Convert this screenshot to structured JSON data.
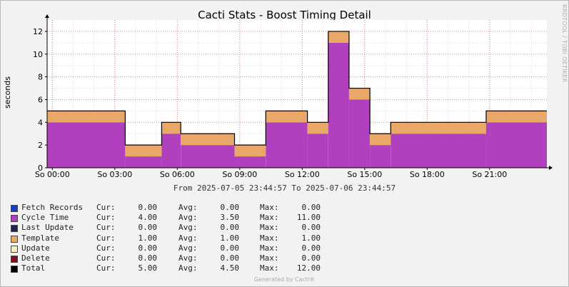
{
  "title": "Cacti Stats - Boost Timing Detail",
  "watermark": "RRDTOOL / TOBI OETIKER",
  "footer": "Generated by Cacti®",
  "chart_data": {
    "type": "area",
    "title": "Cacti Stats - Boost Timing Detail",
    "ylabel": "seconds",
    "xlabel": "",
    "date_range": "From 2025-07-05 23:44:57 To 2025-07-06 23:44:57",
    "ylim": [
      0,
      13
    ],
    "yticks": [
      0,
      2,
      4,
      6,
      8,
      10,
      12
    ],
    "xlim": [
      "2025-07-05 23:44:57",
      "2025-07-06 23:44:57"
    ],
    "xticks": [
      {
        "t": "2025-07-06 00:00",
        "label": "So 00:00"
      },
      {
        "t": "2025-07-06 03:00",
        "label": "So 03:00"
      },
      {
        "t": "2025-07-06 06:00",
        "label": "So 06:00"
      },
      {
        "t": "2025-07-06 09:00",
        "label": "So 09:00"
      },
      {
        "t": "2025-07-06 12:00",
        "label": "So 12:00"
      },
      {
        "t": "2025-07-06 15:00",
        "label": "So 15:00"
      },
      {
        "t": "2025-07-06 18:00",
        "label": "So 18:00"
      },
      {
        "t": "2025-07-06 21:00",
        "label": "So 21:00"
      }
    ],
    "grid": true,
    "stacked": true,
    "series_colors": {
      "Cycle Time": "#b140be",
      "Template": "#e8a868",
      "Total": "#000000"
    },
    "segments": [
      {
        "start": "2025-07-05 23:44:57",
        "end": "2025-07-06 03:30",
        "cycle": 4,
        "template": 1
      },
      {
        "start": "2025-07-06 03:30",
        "end": "2025-07-06 05:15",
        "cycle": 1,
        "template": 1
      },
      {
        "start": "2025-07-06 05:15",
        "end": "2025-07-06 06:10",
        "cycle": 3,
        "template": 1
      },
      {
        "start": "2025-07-06 06:10",
        "end": "2025-07-06 08:45",
        "cycle": 2,
        "template": 1
      },
      {
        "start": "2025-07-06 08:45",
        "end": "2025-07-06 10:15",
        "cycle": 1,
        "template": 1
      },
      {
        "start": "2025-07-06 10:15",
        "end": "2025-07-06 12:15",
        "cycle": 4,
        "template": 1
      },
      {
        "start": "2025-07-06 12:15",
        "end": "2025-07-06 13:15",
        "cycle": 3,
        "template": 1
      },
      {
        "start": "2025-07-06 13:15",
        "end": "2025-07-06 14:15",
        "cycle": 11,
        "template": 1
      },
      {
        "start": "2025-07-06 14:15",
        "end": "2025-07-06 15:15",
        "cycle": 6,
        "template": 1
      },
      {
        "start": "2025-07-06 15:15",
        "end": "2025-07-06 16:15",
        "cycle": 2,
        "template": 1
      },
      {
        "start": "2025-07-06 16:15",
        "end": "2025-07-06 20:50",
        "cycle": 3,
        "template": 1
      },
      {
        "start": "2025-07-06 20:50",
        "end": "2025-07-06 23:44:57",
        "cycle": 4,
        "template": 1
      }
    ]
  },
  "legend": [
    {
      "name": "Fetch Records",
      "color": "#1a3fbf",
      "cur_label": "Cur:",
      "cur": "0.00",
      "avg_label": "Avg:",
      "avg": "0.00",
      "max_label": "Max:",
      "max": "0.00"
    },
    {
      "name": "Cycle Time",
      "color": "#b140be",
      "cur_label": "Cur:",
      "cur": "4.00",
      "avg_label": "Avg:",
      "avg": "3.50",
      "max_label": "Max:",
      "max": "11.00"
    },
    {
      "name": "Last Update",
      "color": "#24244a",
      "cur_label": "Cur:",
      "cur": "0.00",
      "avg_label": "Avg:",
      "avg": "0.00",
      "max_label": "Max:",
      "max": "0.00"
    },
    {
      "name": "Template",
      "color": "#e8a868",
      "cur_label": "Cur:",
      "cur": "1.00",
      "avg_label": "Avg:",
      "avg": "1.00",
      "max_label": "Max:",
      "max": "1.00"
    },
    {
      "name": "Update",
      "color": "#f4f0c0",
      "cur_label": "Cur:",
      "cur": "0.00",
      "avg_label": "Avg:",
      "avg": "0.00",
      "max_label": "Max:",
      "max": "0.00"
    },
    {
      "name": "Delete",
      "color": "#7a1020",
      "cur_label": "Cur:",
      "cur": "0.00",
      "avg_label": "Avg:",
      "avg": "0.00",
      "max_label": "Max:",
      "max": "0.00"
    },
    {
      "name": "Total",
      "color": "#000000",
      "cur_label": "Cur:",
      "cur": "5.00",
      "avg_label": "Avg:",
      "avg": "4.50",
      "max_label": "Max:",
      "max": "12.00"
    }
  ]
}
